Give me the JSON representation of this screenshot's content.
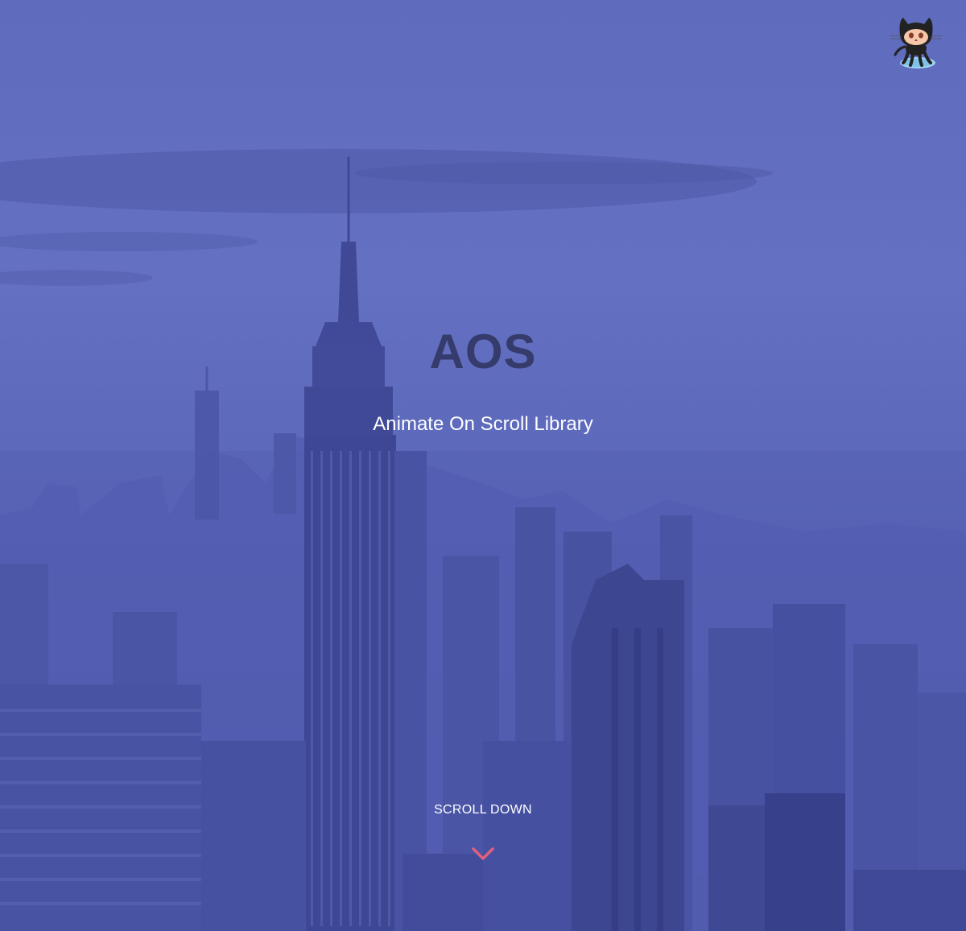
{
  "hero": {
    "title": "AOS",
    "subtitle": "Animate On Scroll Library",
    "scroll_label": "SCROLL DOWN"
  },
  "icons": {
    "github": "octocat-icon",
    "scroll": "chevron-down-icon"
  },
  "colors": {
    "overlay": "#5f6bbd",
    "title": "#353c6b",
    "subtitle": "#ffffff",
    "chevron": "#e0607e"
  }
}
